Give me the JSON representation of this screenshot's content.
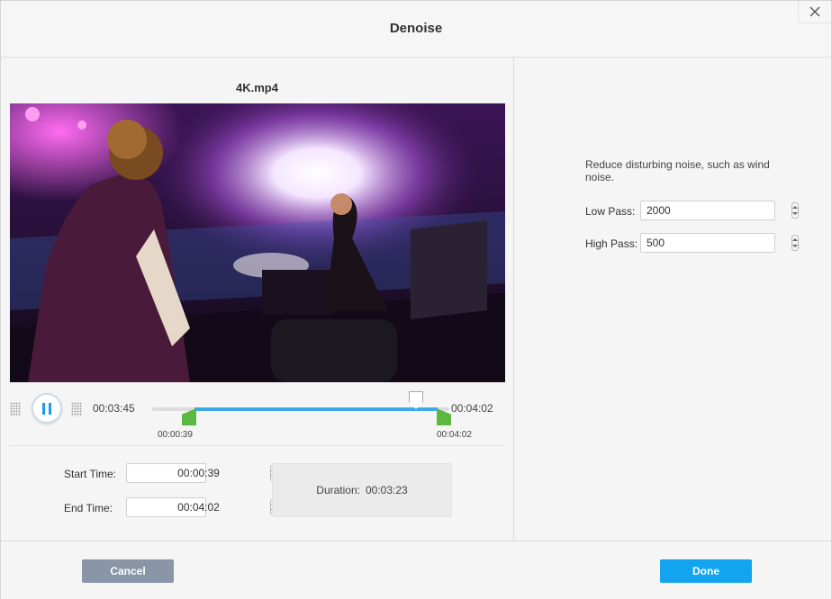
{
  "dialog": {
    "title": "Denoise"
  },
  "preview": {
    "filename": "4K.mp4",
    "current_time": "00:03:45",
    "end_time_display": "00:04:02",
    "marker_start_label": "00:00:39",
    "marker_end_label": "00:04:02"
  },
  "trim": {
    "start_label": "Start Time:",
    "start_value": "00:00:39",
    "end_label": "End Time:",
    "end_value": "00:04:02",
    "duration_label": "Duration:",
    "duration_value": "00:03:23"
  },
  "settings": {
    "description": "Reduce disturbing noise, such as wind noise.",
    "low_pass_label": "Low Pass:",
    "low_pass_value": "2000",
    "high_pass_label": "High Pass:",
    "high_pass_value": "500"
  },
  "footer": {
    "cancel_label": "Cancel",
    "done_label": "Done"
  },
  "colors": {
    "accent": "#12a4ef",
    "track": "#3ba8ea",
    "marker": "#5cb83f",
    "cancel": "#8a95a7"
  }
}
